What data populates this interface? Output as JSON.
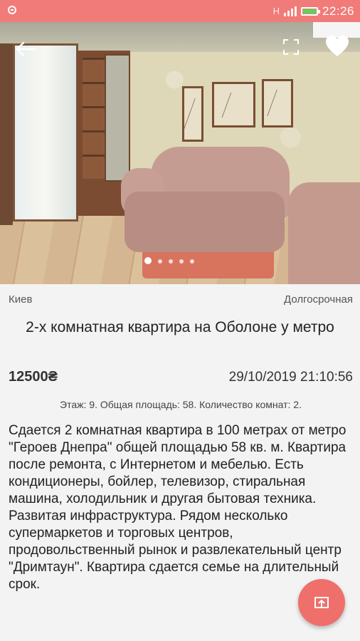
{
  "status_bar": {
    "network_label": "H",
    "battery_level": 0.9,
    "time": "22:26"
  },
  "gallery": {
    "photo_count": 5,
    "active_index": 0
  },
  "listing": {
    "city": "Киев",
    "rent_type": "Долгосрочная",
    "title": "2-х комнатная квартира на Оболоне у метро",
    "price": "12500₴",
    "date": "29/10/2019 21:10:56",
    "details": "Этаж: 9. Общая площадь: 58. Количество комнат: 2.",
    "description": "Сдается 2 комнатная квартира в 100 метрах от метро \"Героев Днепра\" общей площадью 58 кв. м. Квартира после ремонта, с Интернетом и мебелью. Есть кондиционеры, бойлер, телевизор, стиральная машина, холодильник и другая бытовая техника. Развитая инфраструктура. Рядом несколько супермаркетов и торговых центров, продовольственный рынок и развлекательный центр \"Дримтаун\". Квартира сдается семье на длительный срок."
  },
  "icons": {
    "back": "back-arrow-icon",
    "fullscreen": "fullscreen-icon",
    "favorite": "heart-icon",
    "share": "share-icon"
  },
  "colors": {
    "accent": "#f07b78",
    "fab": "#ef6f6a",
    "background": "#f3f3f3"
  }
}
